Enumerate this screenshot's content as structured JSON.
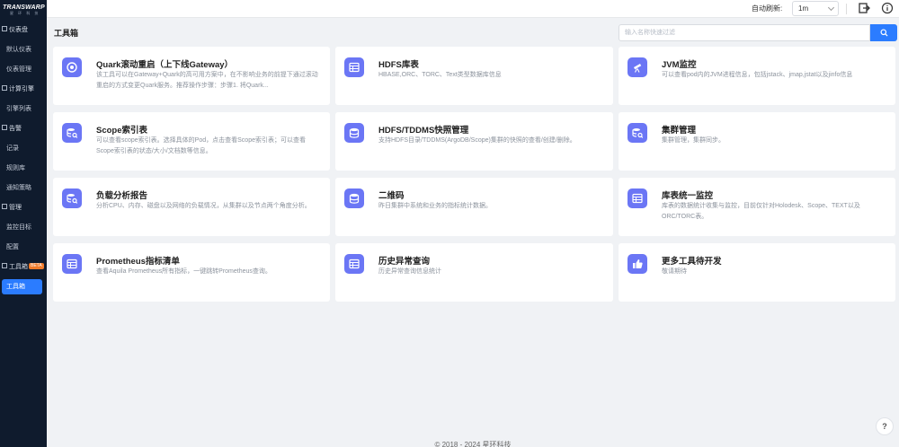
{
  "logo": {
    "main": "TRANSWARP",
    "sub": "星 环 科 技"
  },
  "sidebar": {
    "items": [
      {
        "label": "仪表盘",
        "type": "group"
      },
      {
        "label": "默认仪表",
        "type": "sub"
      },
      {
        "label": "仪表管理",
        "type": "sub"
      },
      {
        "label": "计算引擎",
        "type": "group"
      },
      {
        "label": "引擎列表",
        "type": "sub"
      },
      {
        "label": "告警",
        "type": "group"
      },
      {
        "label": "记录",
        "type": "sub"
      },
      {
        "label": "规则库",
        "type": "sub"
      },
      {
        "label": "通知策略",
        "type": "sub"
      },
      {
        "label": "管理",
        "type": "group"
      },
      {
        "label": "监控目标",
        "type": "sub"
      },
      {
        "label": "配置",
        "type": "sub"
      },
      {
        "label": "工具箱",
        "type": "group",
        "badge": "BETA"
      },
      {
        "label": "工具箱",
        "type": "active"
      }
    ]
  },
  "topbar": {
    "refresh_label": "自动刷新:",
    "refresh_value": "1m"
  },
  "main": {
    "title": "工具箱",
    "search_placeholder": "输入名称快速过滤",
    "cards": [
      {
        "title": "Quark滚动重启（上下线Gateway）",
        "desc": "该工具可以在Gateway+Quark的高可用方案中，在不影响业务的前提下通过滚动重启的方式变更Quark服务。推荐操作步骤：步骤1. 将Quark...",
        "icon": "restart-icon"
      },
      {
        "title": "HDFS库表",
        "desc": "HBASE,ORC、TORC、Text类型数据库信息",
        "icon": "table-icon"
      },
      {
        "title": "JVM监控",
        "desc": "可以查看pod内的JVM进程信息，包括jstack、jmap,jstat以及jinfo信息",
        "icon": "telescope-icon"
      },
      {
        "title": "Scope索引表",
        "desc": "可以查看scope索引表。选择具体的Pod，点击查看Scope索引表；可以查看Scope索引表的状态/大小/文档数等信息。",
        "icon": "db-search-icon"
      },
      {
        "title": "HDFS/TDDMS快照管理",
        "desc": "支持HDFS目录/TDDMS(ArgoDB/Scope)集群的快照的查看/创建/删除。",
        "icon": "database-icon"
      },
      {
        "title": "集群管理",
        "desc": "集群管理，集群同步。",
        "icon": "db-search-icon"
      },
      {
        "title": "负载分析报告",
        "desc": "分析CPU、内存、磁盘以及网络的负载情况，从集群以及节点两个角度分析。",
        "icon": "db-search-icon"
      },
      {
        "title": "二维码",
        "desc": "昨日集群中系统和业务的指标统计数据。",
        "icon": "database-icon"
      },
      {
        "title": "库表统一监控",
        "desc": "库表的数据统计收集与监控，目前仅针对Holodesk、Scope、TEXT以及ORC/TORC表。",
        "icon": "table-icon"
      },
      {
        "title": "Prometheus指标清单",
        "desc": "查看Aquila Prometheus所有指标，一键跳转Prometheus查询。",
        "icon": "table-icon"
      },
      {
        "title": "历史异常查询",
        "desc": "历史异常查询信息统计",
        "icon": "table-icon"
      },
      {
        "title": "更多工具待开发",
        "desc": "敬请期待",
        "icon": "thumbs-up-icon"
      }
    ]
  },
  "footer": {
    "text": "© 2018 - 2024 星环科技"
  },
  "colors": {
    "sidebar_bg": "#0f1b2d",
    "accent": "#2b7cff",
    "card_icon_bg": "#6b76f5",
    "page_bg": "#f0f2f5"
  }
}
